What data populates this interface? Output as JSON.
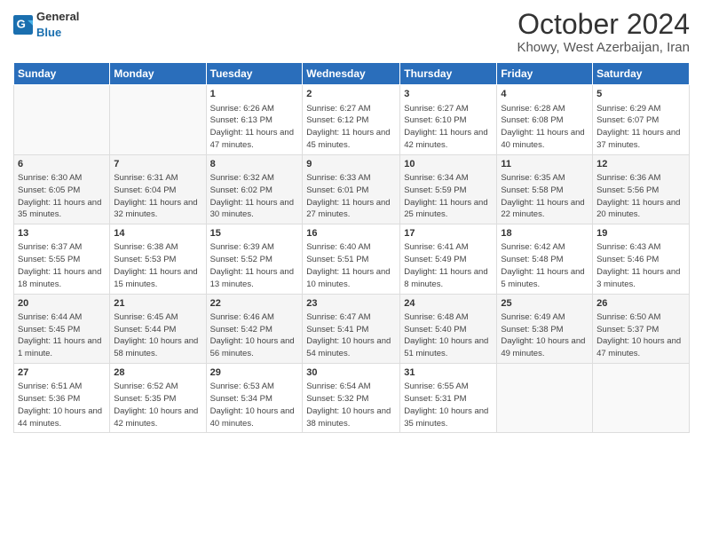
{
  "logo": {
    "text_general": "General",
    "text_blue": "Blue"
  },
  "title": "October 2024",
  "subtitle": "Khowy, West Azerbaijan, Iran",
  "weekdays": [
    "Sunday",
    "Monday",
    "Tuesday",
    "Wednesday",
    "Thursday",
    "Friday",
    "Saturday"
  ],
  "weeks": [
    [
      {
        "day": null
      },
      {
        "day": null
      },
      {
        "day": "1",
        "sunrise": "Sunrise: 6:26 AM",
        "sunset": "Sunset: 6:13 PM",
        "daylight": "Daylight: 11 hours and 47 minutes."
      },
      {
        "day": "2",
        "sunrise": "Sunrise: 6:27 AM",
        "sunset": "Sunset: 6:12 PM",
        "daylight": "Daylight: 11 hours and 45 minutes."
      },
      {
        "day": "3",
        "sunrise": "Sunrise: 6:27 AM",
        "sunset": "Sunset: 6:10 PM",
        "daylight": "Daylight: 11 hours and 42 minutes."
      },
      {
        "day": "4",
        "sunrise": "Sunrise: 6:28 AM",
        "sunset": "Sunset: 6:08 PM",
        "daylight": "Daylight: 11 hours and 40 minutes."
      },
      {
        "day": "5",
        "sunrise": "Sunrise: 6:29 AM",
        "sunset": "Sunset: 6:07 PM",
        "daylight": "Daylight: 11 hours and 37 minutes."
      }
    ],
    [
      {
        "day": "6",
        "sunrise": "Sunrise: 6:30 AM",
        "sunset": "Sunset: 6:05 PM",
        "daylight": "Daylight: 11 hours and 35 minutes."
      },
      {
        "day": "7",
        "sunrise": "Sunrise: 6:31 AM",
        "sunset": "Sunset: 6:04 PM",
        "daylight": "Daylight: 11 hours and 32 minutes."
      },
      {
        "day": "8",
        "sunrise": "Sunrise: 6:32 AM",
        "sunset": "Sunset: 6:02 PM",
        "daylight": "Daylight: 11 hours and 30 minutes."
      },
      {
        "day": "9",
        "sunrise": "Sunrise: 6:33 AM",
        "sunset": "Sunset: 6:01 PM",
        "daylight": "Daylight: 11 hours and 27 minutes."
      },
      {
        "day": "10",
        "sunrise": "Sunrise: 6:34 AM",
        "sunset": "Sunset: 5:59 PM",
        "daylight": "Daylight: 11 hours and 25 minutes."
      },
      {
        "day": "11",
        "sunrise": "Sunrise: 6:35 AM",
        "sunset": "Sunset: 5:58 PM",
        "daylight": "Daylight: 11 hours and 22 minutes."
      },
      {
        "day": "12",
        "sunrise": "Sunrise: 6:36 AM",
        "sunset": "Sunset: 5:56 PM",
        "daylight": "Daylight: 11 hours and 20 minutes."
      }
    ],
    [
      {
        "day": "13",
        "sunrise": "Sunrise: 6:37 AM",
        "sunset": "Sunset: 5:55 PM",
        "daylight": "Daylight: 11 hours and 18 minutes."
      },
      {
        "day": "14",
        "sunrise": "Sunrise: 6:38 AM",
        "sunset": "Sunset: 5:53 PM",
        "daylight": "Daylight: 11 hours and 15 minutes."
      },
      {
        "day": "15",
        "sunrise": "Sunrise: 6:39 AM",
        "sunset": "Sunset: 5:52 PM",
        "daylight": "Daylight: 11 hours and 13 minutes."
      },
      {
        "day": "16",
        "sunrise": "Sunrise: 6:40 AM",
        "sunset": "Sunset: 5:51 PM",
        "daylight": "Daylight: 11 hours and 10 minutes."
      },
      {
        "day": "17",
        "sunrise": "Sunrise: 6:41 AM",
        "sunset": "Sunset: 5:49 PM",
        "daylight": "Daylight: 11 hours and 8 minutes."
      },
      {
        "day": "18",
        "sunrise": "Sunrise: 6:42 AM",
        "sunset": "Sunset: 5:48 PM",
        "daylight": "Daylight: 11 hours and 5 minutes."
      },
      {
        "day": "19",
        "sunrise": "Sunrise: 6:43 AM",
        "sunset": "Sunset: 5:46 PM",
        "daylight": "Daylight: 11 hours and 3 minutes."
      }
    ],
    [
      {
        "day": "20",
        "sunrise": "Sunrise: 6:44 AM",
        "sunset": "Sunset: 5:45 PM",
        "daylight": "Daylight: 11 hours and 1 minute."
      },
      {
        "day": "21",
        "sunrise": "Sunrise: 6:45 AM",
        "sunset": "Sunset: 5:44 PM",
        "daylight": "Daylight: 10 hours and 58 minutes."
      },
      {
        "day": "22",
        "sunrise": "Sunrise: 6:46 AM",
        "sunset": "Sunset: 5:42 PM",
        "daylight": "Daylight: 10 hours and 56 minutes."
      },
      {
        "day": "23",
        "sunrise": "Sunrise: 6:47 AM",
        "sunset": "Sunset: 5:41 PM",
        "daylight": "Daylight: 10 hours and 54 minutes."
      },
      {
        "day": "24",
        "sunrise": "Sunrise: 6:48 AM",
        "sunset": "Sunset: 5:40 PM",
        "daylight": "Daylight: 10 hours and 51 minutes."
      },
      {
        "day": "25",
        "sunrise": "Sunrise: 6:49 AM",
        "sunset": "Sunset: 5:38 PM",
        "daylight": "Daylight: 10 hours and 49 minutes."
      },
      {
        "day": "26",
        "sunrise": "Sunrise: 6:50 AM",
        "sunset": "Sunset: 5:37 PM",
        "daylight": "Daylight: 10 hours and 47 minutes."
      }
    ],
    [
      {
        "day": "27",
        "sunrise": "Sunrise: 6:51 AM",
        "sunset": "Sunset: 5:36 PM",
        "daylight": "Daylight: 10 hours and 44 minutes."
      },
      {
        "day": "28",
        "sunrise": "Sunrise: 6:52 AM",
        "sunset": "Sunset: 5:35 PM",
        "daylight": "Daylight: 10 hours and 42 minutes."
      },
      {
        "day": "29",
        "sunrise": "Sunrise: 6:53 AM",
        "sunset": "Sunset: 5:34 PM",
        "daylight": "Daylight: 10 hours and 40 minutes."
      },
      {
        "day": "30",
        "sunrise": "Sunrise: 6:54 AM",
        "sunset": "Sunset: 5:32 PM",
        "daylight": "Daylight: 10 hours and 38 minutes."
      },
      {
        "day": "31",
        "sunrise": "Sunrise: 6:55 AM",
        "sunset": "Sunset: 5:31 PM",
        "daylight": "Daylight: 10 hours and 35 minutes."
      },
      {
        "day": null
      },
      {
        "day": null
      }
    ]
  ]
}
